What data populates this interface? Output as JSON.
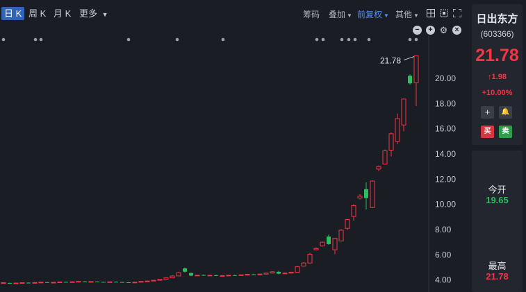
{
  "tabs": [
    {
      "label": "日 K",
      "active": true
    },
    {
      "label": "周 K",
      "active": false
    },
    {
      "label": "月 K",
      "active": false
    },
    {
      "label": "更多",
      "active": false
    }
  ],
  "tools": {
    "chips": "筹码",
    "overlay": "叠加",
    "adjust": "前复权",
    "other": "其他"
  },
  "stock": {
    "name": "日出东方",
    "code": "(603366)",
    "price": "21.78",
    "change": "1.98",
    "pct": "+10.00%",
    "buy": "买",
    "sell": "卖"
  },
  "stats": {
    "open_label": "今开",
    "open_value": "19.65",
    "high_label": "最高",
    "high_value": "21.78"
  },
  "colors": {
    "up": "#f23645",
    "down": "#2ebd5f",
    "accent": "#4f8ff7",
    "text": "#c9ccd4"
  },
  "chart_data": {
    "type": "candlestick",
    "y_ticks": [
      "20.00",
      "18.00",
      "16.00",
      "14.00",
      "12.00",
      "10.00",
      "8.00",
      "6.00",
      "4.00"
    ],
    "ylim": [
      3.6,
      22.8
    ],
    "annotation": "21.78",
    "candles": [
      [
        3.76,
        3.79,
        3.81,
        3.74
      ],
      [
        3.77,
        3.74,
        3.79,
        3.72
      ],
      [
        3.73,
        3.76,
        3.78,
        3.71
      ],
      [
        3.76,
        3.79,
        3.81,
        3.74
      ],
      [
        3.79,
        3.76,
        3.81,
        3.74
      ],
      [
        3.76,
        3.8,
        3.82,
        3.75
      ],
      [
        3.8,
        3.83,
        3.85,
        3.78
      ],
      [
        3.83,
        3.8,
        3.85,
        3.78
      ],
      [
        3.8,
        3.82,
        3.84,
        3.78
      ],
      [
        3.82,
        3.85,
        3.87,
        3.8
      ],
      [
        3.85,
        3.83,
        3.87,
        3.81
      ],
      [
        3.83,
        3.86,
        3.88,
        3.81
      ],
      [
        3.86,
        3.89,
        3.91,
        3.84
      ],
      [
        3.89,
        3.86,
        3.91,
        3.84
      ],
      [
        3.86,
        3.88,
        3.9,
        3.84
      ],
      [
        3.88,
        3.85,
        3.9,
        3.83
      ],
      [
        3.85,
        3.83,
        3.87,
        3.81
      ],
      [
        3.83,
        3.86,
        3.88,
        3.81
      ],
      [
        3.86,
        3.84,
        3.88,
        3.82
      ],
      [
        3.84,
        3.82,
        3.86,
        3.8
      ],
      [
        3.82,
        3.79,
        3.84,
        3.77
      ],
      [
        3.79,
        3.83,
        3.85,
        3.77
      ],
      [
        3.83,
        3.89,
        3.92,
        3.81
      ],
      [
        3.89,
        3.92,
        3.95,
        3.87
      ],
      [
        3.92,
        3.98,
        4.01,
        3.9
      ],
      [
        3.98,
        4.06,
        4.09,
        3.96
      ],
      [
        4.06,
        4.17,
        4.21,
        4.04
      ],
      [
        4.17,
        4.32,
        4.37,
        4.15
      ],
      [
        4.32,
        4.58,
        4.65,
        4.3
      ],
      [
        4.92,
        4.66,
        4.98,
        4.6
      ],
      [
        4.55,
        4.35,
        4.6,
        4.3
      ],
      [
        4.35,
        4.38,
        4.42,
        4.32
      ],
      [
        4.4,
        4.35,
        4.45,
        4.32
      ],
      [
        4.35,
        4.38,
        4.42,
        4.32
      ],
      [
        4.38,
        4.32,
        4.42,
        4.3
      ],
      [
        4.32,
        4.35,
        4.38,
        4.3
      ],
      [
        4.35,
        4.38,
        4.42,
        4.32
      ],
      [
        4.38,
        4.36,
        4.42,
        4.32
      ],
      [
        4.36,
        4.41,
        4.44,
        4.33
      ],
      [
        4.41,
        4.45,
        4.48,
        4.38
      ],
      [
        4.45,
        4.43,
        4.5,
        4.4
      ],
      [
        4.43,
        4.47,
        4.5,
        4.4
      ],
      [
        4.47,
        4.55,
        4.58,
        4.44
      ],
      [
        4.55,
        4.65,
        4.7,
        4.52
      ],
      [
        4.65,
        4.5,
        4.72,
        4.46
      ],
      [
        4.5,
        4.55,
        4.6,
        4.48
      ],
      [
        4.55,
        4.62,
        4.66,
        4.52
      ],
      [
        4.62,
        5.05,
        5.1,
        4.6
      ],
      [
        5.1,
        5.35,
        5.42,
        5.05
      ],
      [
        5.35,
        6.05,
        6.15,
        5.32
      ],
      [
        6.4,
        6.5,
        6.6,
        6.35
      ],
      [
        6.7,
        7.0,
        7.05,
        6.65
      ],
      [
        7.45,
        6.85,
        7.6,
        6.8
      ],
      [
        6.4,
        7.3,
        7.35,
        6.05
      ],
      [
        7.1,
        7.95,
        8.05,
        7.05
      ],
      [
        8.1,
        8.8,
        8.85,
        7.95
      ],
      [
        9.05,
        9.9,
        10.0,
        8.7
      ],
      [
        10.5,
        10.65,
        10.8,
        10.4
      ],
      [
        11.2,
        10.5,
        11.75,
        9.6
      ],
      [
        9.75,
        11.85,
        11.9,
        9.7
      ],
      [
        12.8,
        13.0,
        13.1,
        12.65
      ],
      [
        13.2,
        14.25,
        14.35,
        13.15
      ],
      [
        14.3,
        15.6,
        15.7,
        13.8
      ],
      [
        15.0,
        16.8,
        17.2,
        14.8
      ],
      [
        16.3,
        18.35,
        18.4,
        15.8
      ],
      [
        20.2,
        19.6,
        20.3,
        19.5
      ],
      [
        19.65,
        21.78,
        21.78,
        17.8
      ]
    ]
  }
}
